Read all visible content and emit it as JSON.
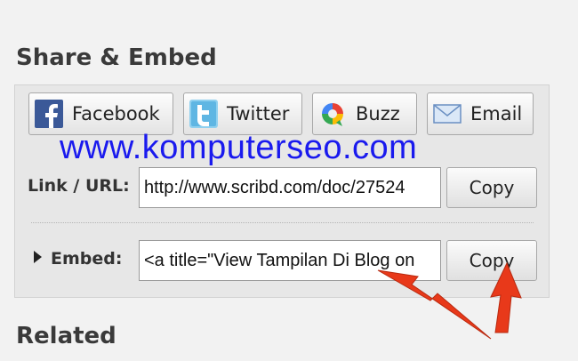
{
  "share": {
    "heading": "Share & Embed",
    "buttons": [
      {
        "label": "Facebook",
        "icon": "facebook-icon"
      },
      {
        "label": "Twitter",
        "icon": "twitter-icon"
      },
      {
        "label": "Buzz",
        "icon": "buzz-icon"
      },
      {
        "label": "Email",
        "icon": "email-icon"
      }
    ]
  },
  "watermark": "www.komputerseo.com",
  "link": {
    "label": "Link / URL:",
    "value": "http://www.scribd.com/doc/27524",
    "copy_label": "Copy"
  },
  "embed": {
    "label": "Embed:",
    "value": "<a title=\"View Tampilan Di Blog on",
    "copy_label": "Copy"
  },
  "related": {
    "heading": "Related"
  },
  "colors": {
    "watermark": "#1a1aee",
    "arrow": "#e8391a",
    "facebook": "#3b5998",
    "twitter": "#5fb6e3"
  }
}
